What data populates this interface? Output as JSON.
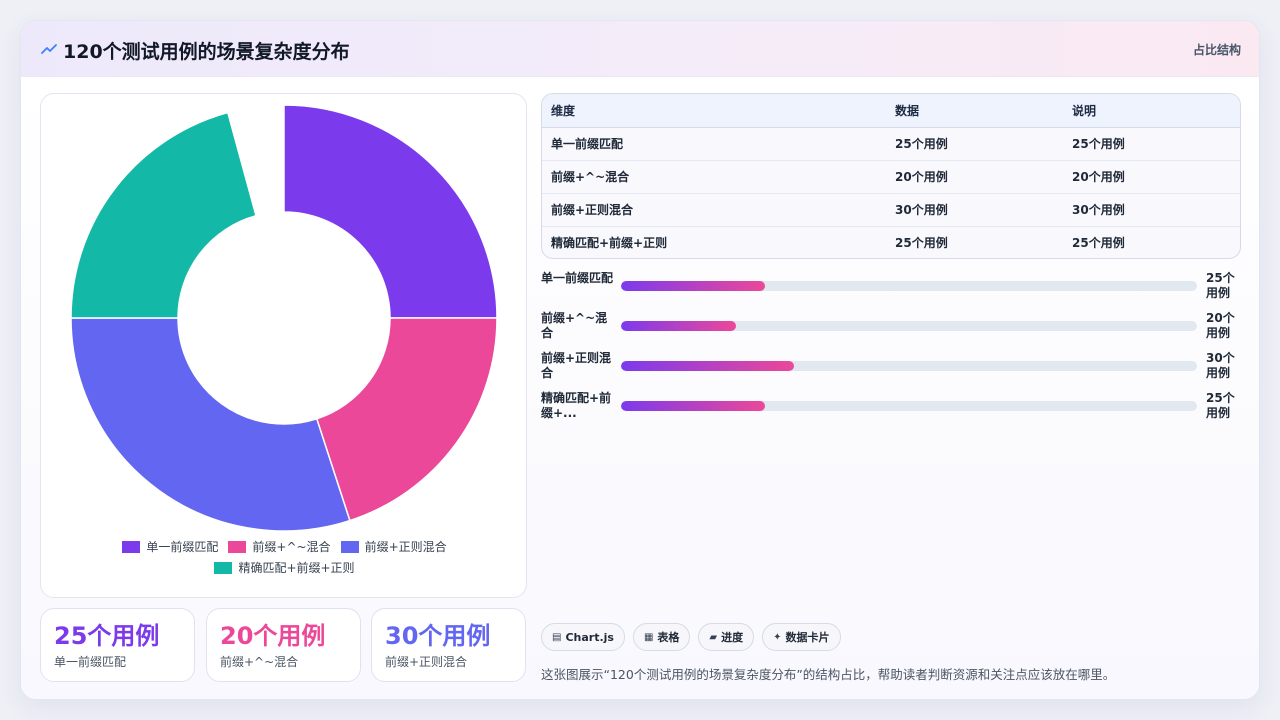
{
  "header": {
    "title": "120个测试用例的场景复杂度分布",
    "tag": "占比结构",
    "icon": "trend-icon"
  },
  "chart_data": {
    "type": "pie",
    "style": "doughnut",
    "categories": [
      "单一前缀匹配",
      "前缀+^~混合",
      "前缀+正则混合",
      "精确匹配+前缀+正则"
    ],
    "values": [
      25,
      20,
      30,
      25
    ],
    "colors": [
      "#7c3aed",
      "#ec4899",
      "#6366f1",
      "#14b8a6"
    ],
    "legend_position": "bottom",
    "hidden_slice_index": 3
  },
  "stats": [
    {
      "value": "25个用例",
      "label": "单一前缀匹配",
      "color": "#7c3aed"
    },
    {
      "value": "20个用例",
      "label": "前缀+^~混合",
      "color": "#ec4899"
    },
    {
      "value": "30个用例",
      "label": "前缀+正则混合",
      "color": "#6366f1"
    }
  ],
  "table": {
    "headers": [
      "维度",
      "数据",
      "说明"
    ],
    "rows": [
      [
        "单一前缀匹配",
        "25个用例",
        "25个用例"
      ],
      [
        "前缀+^~混合",
        "20个用例",
        "20个用例"
      ],
      [
        "前缀+正则混合",
        "30个用例",
        "30个用例"
      ],
      [
        "精确匹配+前缀+正则",
        "25个用例",
        "25个用例"
      ]
    ]
  },
  "progress": {
    "max": 100,
    "items": [
      {
        "label": "单一前缀匹配",
        "value": 25,
        "value_text": "25个用例"
      },
      {
        "label": "前缀+^~混合",
        "value": 20,
        "value_text": "20个用例"
      },
      {
        "label": "前缀+正则混合",
        "value": 30,
        "value_text": "30个用例"
      },
      {
        "label": "精确匹配+前缀+...",
        "value": 25,
        "value_text": "25个用例"
      }
    ]
  },
  "chips": [
    {
      "icon": "chart-icon",
      "glyph": "▤",
      "label": "Chart.js"
    },
    {
      "icon": "table-icon",
      "glyph": "▦",
      "label": "表格"
    },
    {
      "icon": "progress-icon",
      "glyph": "▰",
      "label": "进度"
    },
    {
      "icon": "sparkle-icon",
      "glyph": "✦",
      "label": "数据卡片"
    }
  ],
  "note": "这张图展示“120个测试用例的场景复杂度分布”的结构占比，帮助读者判断资源和关注点应该放在哪里。"
}
